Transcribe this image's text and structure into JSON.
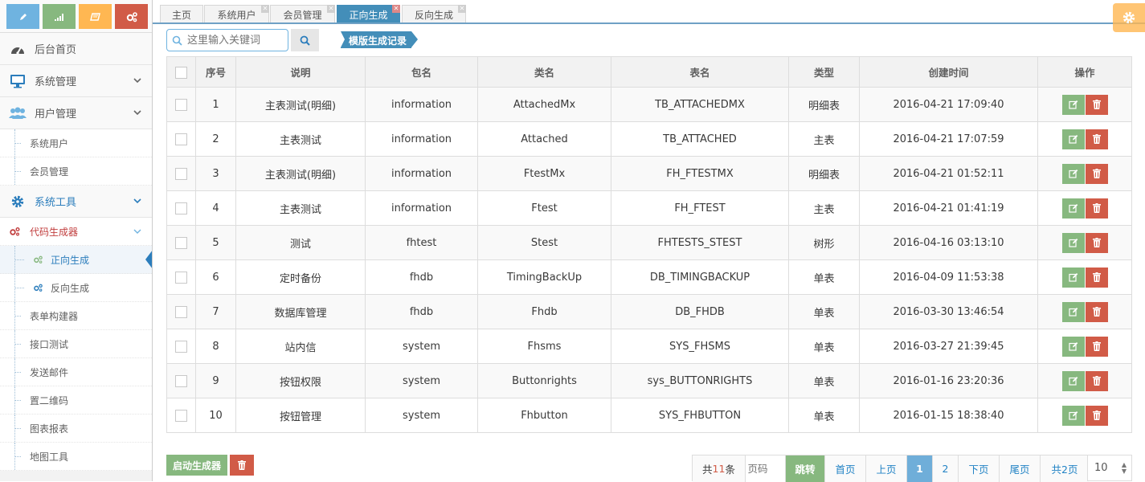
{
  "sidebar": {
    "shortcuts": [
      "pencil-icon",
      "signal-icon",
      "book-icon",
      "cogs-icon"
    ],
    "items": [
      {
        "label": "后台首页",
        "icon": "tachometer-icon"
      },
      {
        "label": "系统管理",
        "icon": "desktop-icon"
      },
      {
        "label": "用户管理",
        "icon": "users-icon"
      },
      {
        "label": "系统用户"
      },
      {
        "label": "会员管理"
      },
      {
        "label": "系统工具",
        "icon": "cog-icon"
      },
      {
        "label": "代码生成器",
        "icon": "cogs-icon"
      },
      {
        "label": "正向生成",
        "icon": "cogs-icon"
      },
      {
        "label": "反向生成",
        "icon": "cogs-icon"
      },
      {
        "label": "表单构建器"
      },
      {
        "label": "接口测试"
      },
      {
        "label": "发送邮件"
      },
      {
        "label": "置二维码"
      },
      {
        "label": "图表报表"
      },
      {
        "label": "地图工具"
      }
    ]
  },
  "tabs": [
    {
      "label": "主页"
    },
    {
      "label": "系统用户"
    },
    {
      "label": "会员管理"
    },
    {
      "label": "正向生成"
    },
    {
      "label": "反向生成"
    }
  ],
  "toolbar": {
    "search_placeholder": "这里输入关键词",
    "record_label": "模版生成记录"
  },
  "table": {
    "headers": [
      "序号",
      "说明",
      "包名",
      "类名",
      "表名",
      "类型",
      "创建时间",
      "操作"
    ],
    "rows": [
      {
        "no": "1",
        "desc": "主表测试(明细)",
        "pkg": "information",
        "cls": "AttachedMx",
        "tbl": "TB_ATTACHEDMX",
        "type": "明细表",
        "time": "2016-04-21 17:09:40"
      },
      {
        "no": "2",
        "desc": "主表测试",
        "pkg": "information",
        "cls": "Attached",
        "tbl": "TB_ATTACHED",
        "type": "主表",
        "time": "2016-04-21 17:07:59"
      },
      {
        "no": "3",
        "desc": "主表测试(明细)",
        "pkg": "information",
        "cls": "FtestMx",
        "tbl": "FH_FTESTMX",
        "type": "明细表",
        "time": "2016-04-21 01:52:11"
      },
      {
        "no": "4",
        "desc": "主表测试",
        "pkg": "information",
        "cls": "Ftest",
        "tbl": "FH_FTEST",
        "type": "主表",
        "time": "2016-04-21 01:41:19"
      },
      {
        "no": "5",
        "desc": "测试",
        "pkg": "fhtest",
        "cls": "Stest",
        "tbl": "FHTESTS_STEST",
        "type": "树形",
        "time": "2016-04-16 03:13:10"
      },
      {
        "no": "6",
        "desc": "定时备份",
        "pkg": "fhdb",
        "cls": "TimingBackUp",
        "tbl": "DB_TIMINGBACKUP",
        "type": "单表",
        "time": "2016-04-09 11:53:38"
      },
      {
        "no": "7",
        "desc": "数据库管理",
        "pkg": "fhdb",
        "cls": "Fhdb",
        "tbl": "DB_FHDB",
        "type": "单表",
        "time": "2016-03-30 13:46:54"
      },
      {
        "no": "8",
        "desc": "站内信",
        "pkg": "system",
        "cls": "Fhsms",
        "tbl": "SYS_FHSMS",
        "type": "单表",
        "time": "2016-03-27 21:39:45"
      },
      {
        "no": "9",
        "desc": "按钮权限",
        "pkg": "system",
        "cls": "Buttonrights",
        "tbl": "sys_BUTTONRIGHTS",
        "type": "单表",
        "time": "2016-01-16 23:20:36"
      },
      {
        "no": "10",
        "desc": "按钮管理",
        "pkg": "system",
        "cls": "Fhbutton",
        "tbl": "SYS_FHBUTTON",
        "type": "单表",
        "time": "2016-01-15 18:38:40"
      }
    ]
  },
  "footer": {
    "start_label": "启动生成器",
    "pager": {
      "total_prefix": "共",
      "total_count": "11",
      "total_suffix": "条",
      "page_placeholder": "页码",
      "jump": "跳转",
      "first": "首页",
      "prev": "上页",
      "pages": [
        "1",
        "2"
      ],
      "current": "1",
      "next": "下页",
      "last": "尾页",
      "page_count": "共2页",
      "page_size": "10"
    }
  },
  "colors": {
    "primary": "#438eb9",
    "success": "#87b87f",
    "danger": "#d15b47",
    "warning": "#ffb752",
    "info": "#6fb3e0"
  }
}
